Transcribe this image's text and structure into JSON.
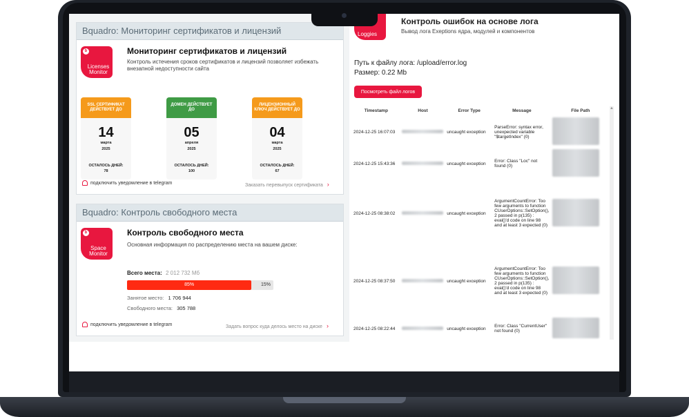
{
  "certs": {
    "header": "Bquadro: Мониторинг сертификатов и лицензий",
    "logo_text": "Licenses Monitor",
    "title": "Мониторинг сертификатов и лицензий",
    "description": "Контроль истечения сроков сертификатов и лицензий позволяет избежать внезапной недоступности сайта",
    "cards": [
      {
        "label": "SSL СЕРТИФИКАТ ДЕЙСТВУЕТ ДО",
        "color": "#f59a1b",
        "day": "14",
        "month": "марта",
        "year": "2025",
        "left_label": "ОСТАЛОСЬ ДНЕЙ:",
        "left_value": "78"
      },
      {
        "label": "ДОМЕН ДЕЙСТВУЕТ ДО",
        "color": "#3f9b45",
        "day": "05",
        "month": "апреля",
        "year": "2025",
        "left_label": "ОСТАЛОСЬ ДНЕЙ:",
        "left_value": "100"
      },
      {
        "label": "ЛИЦЕНЗИОННЫЙ КЛЮЧ ДЕЙСТВУЕТ ДО",
        "color": "#f59a1b",
        "day": "04",
        "month": "марта",
        "year": "2025",
        "left_label": "ОСТАЛОСЬ ДНЕЙ:",
        "left_value": "67"
      }
    ],
    "notify": "подключить уведомление в telegram",
    "order_link": "Заказать перевыпуск сертификата"
  },
  "space": {
    "header": "Bquadro: Контроль свободного места",
    "logo_text": "Space Monitor",
    "title": "Контроль свободного места",
    "description": "Основная информация по распределению места на вашем диске:",
    "total_label": "Всего места:",
    "total_value": "2 012 732 Мб",
    "used_percent": 85,
    "used_percent_text": "85%",
    "free_percent_text": "15%",
    "used_label": "Занятое место:",
    "used_value": "1 706 944",
    "free_label": "Свободного места:",
    "free_value": "305 788",
    "notify": "подключить уведомление в telegram",
    "ask_link": "Задать вопрос куда делось место на диске"
  },
  "loggies": {
    "logo_text": "Loggies",
    "title": "Контроль ошибок на основе лога",
    "subtitle": "Вывод лога Exeptions ядра, модулей и компонентов",
    "path": "Путь к файлу лога: /upload/error.log",
    "size": "Размер: 0.22 Mb",
    "button": "Посмотреть файл логов",
    "columns": [
      "Timestamp",
      "Host",
      "Error Type",
      "Message",
      "File Path"
    ],
    "rows": [
      {
        "timestamp": "2024-12-25 16:07:03",
        "type": "uncaught exception",
        "message": "ParseError: syntax error, unexpected variable \"$targetIndex\" (0)"
      },
      {
        "timestamp": "2024-12-25 15:43:36",
        "type": "uncaught exception",
        "message": "Error: Class \"Loc\" not found (0)"
      },
      {
        "timestamp": "2024-12-25 08:38:02",
        "type": "uncaught exception",
        "message": "ArgumentCountError: Too few arguments to function CUserOptions::SetOption(), 2 passed in p(135) : eval()'d code on line 98 and at least 3 expected (0)"
      },
      {
        "timestamp": "2024-12-25 08:37:50",
        "type": "uncaught exception",
        "message": "ArgumentCountError: Too few arguments to function CUserOptions::SetOption(), 2 passed in p(135) : eval()'d code on line 98 and at least 3 expected (0)"
      },
      {
        "timestamp": "2024-12-25 08:22:44",
        "type": "uncaught exception",
        "message": "Error: Class \"CurrentUser\" not found (0)"
      }
    ]
  },
  "colors": {
    "accent": "#e8173f",
    "orange": "#f59a1b",
    "green": "#3f9b45",
    "used_bar": "#ff2a12"
  }
}
